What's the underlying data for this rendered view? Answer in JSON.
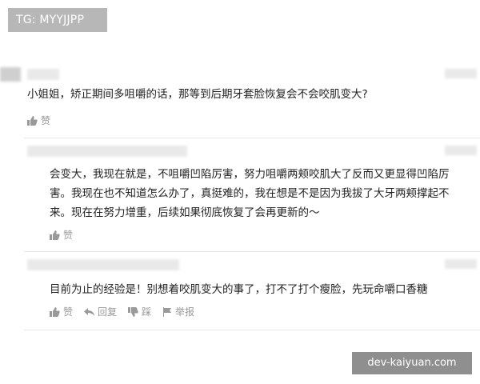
{
  "badge": {
    "text": "TG: MYYJJPP"
  },
  "comments": [
    {
      "text": "小姐姐，矫正期间多咀嚼的话，那等到后期牙套脸恢复会不会咬肌变大?",
      "like_label": "赞"
    }
  ],
  "replies": [
    {
      "lines": [
        "会变大，我现在就是，不咀嚼凹陷厉害，努力咀嚼两颊咬肌大了反而又更显得凹陷厉",
        "害。我现在也不知道怎么办了，真挺难的，我在想是不是因为我拔了大牙两颊撑起不",
        "来。现在在努力增重，后续如果彻底恢复了会再更新的～"
      ],
      "like_label": "赞"
    },
    {
      "lines": [
        "目前为止的经验是！别想着咬肌变大的事了，打不了打个瘦脸，先玩命嚼口香糖"
      ],
      "like_label": "赞",
      "reply_label": "回复",
      "dislike_label": "踩",
      "report_label": "举报"
    }
  ],
  "watermark": {
    "text": "dev-kaiyuan.com"
  },
  "colors": {
    "badge_bg": "#b7b7b7",
    "watermark_bg": "#8f8f8f",
    "action_gray": "#999999"
  }
}
